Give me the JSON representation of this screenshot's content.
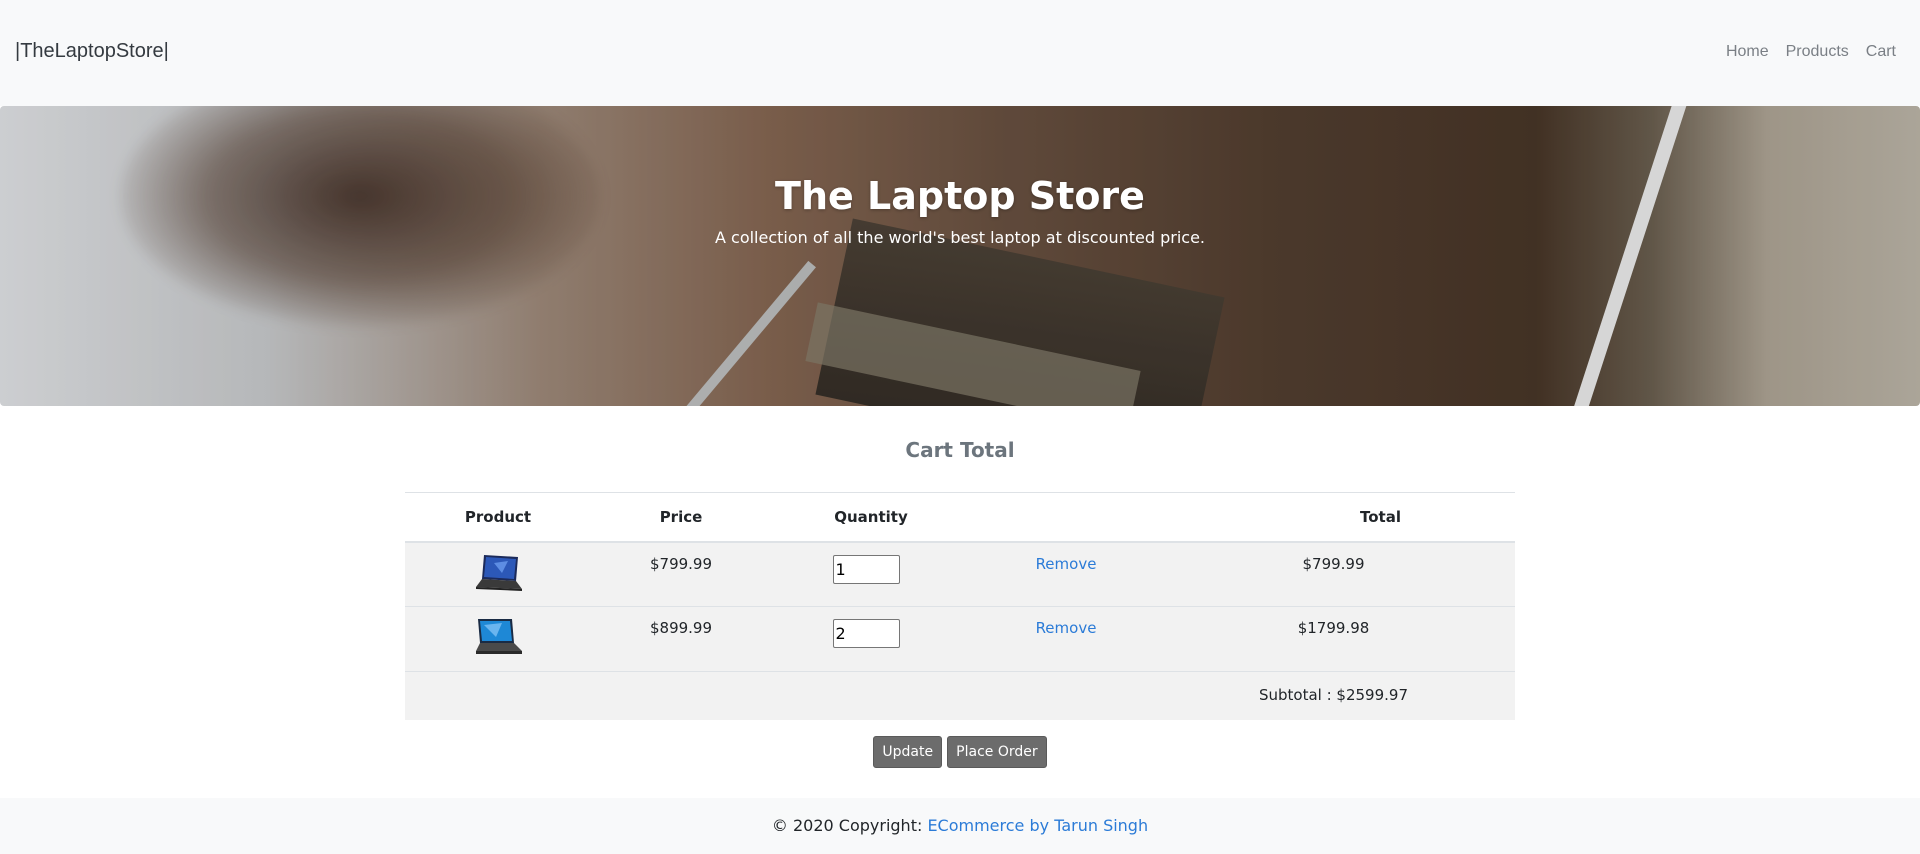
{
  "navbar": {
    "brand": "|TheLaptopStore|",
    "links": [
      "Home",
      "Products",
      "Cart"
    ]
  },
  "hero": {
    "title": "The Laptop Store",
    "subtitle": "A collection of all the world's best laptop at discounted price."
  },
  "cart": {
    "heading": "Cart Total",
    "columns": {
      "product": "Product",
      "price": "Price",
      "quantity": "Quantity",
      "remove": "",
      "total": "Total"
    },
    "rows": [
      {
        "product_icon": "laptop-icon",
        "price": "$799.99",
        "quantity": "1",
        "remove_label": "Remove",
        "total": "$799.99"
      },
      {
        "product_icon": "laptop-icon",
        "price": "$899.99",
        "quantity": "2",
        "remove_label": "Remove",
        "total": "$1799.98"
      }
    ],
    "subtotal": "Subtotal : $2599.97",
    "update_label": "Update",
    "place_order_label": "Place Order"
  },
  "footer": {
    "copyright": "© 2020 Copyright: ",
    "link_text": "ECommerce by Tarun Singh"
  },
  "colors": {
    "navbar_bg": "#f8f9fa",
    "link": "#2b7bd7",
    "button_bg": "#6c6c6c",
    "row_bg": "#f2f2f2"
  }
}
